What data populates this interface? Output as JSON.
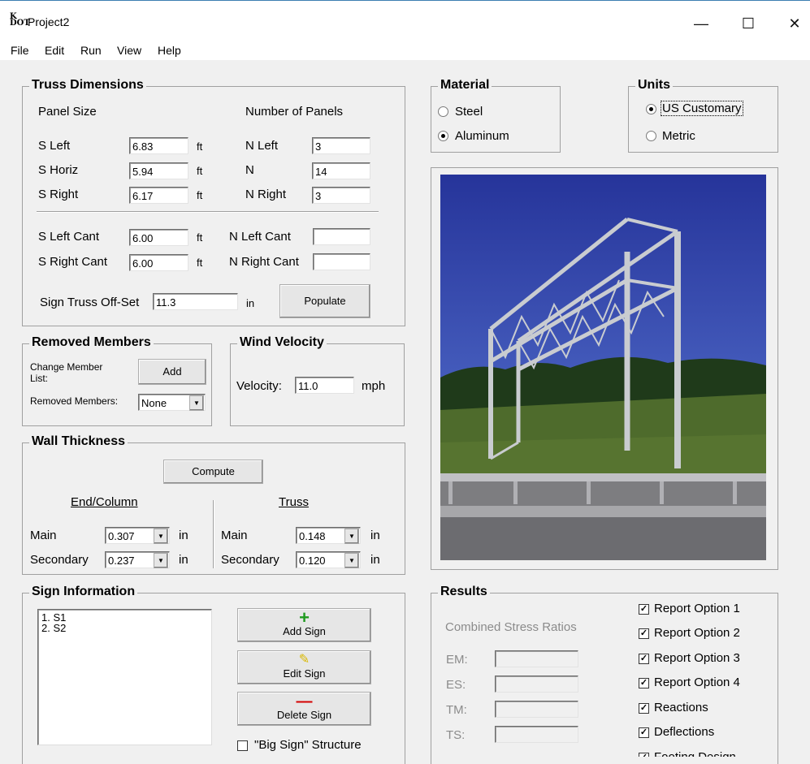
{
  "window": {
    "title": "Project2",
    "app_icon_top": "K",
    "app_icon_bottom": "DOT",
    "minimize": "—",
    "maximize": "☐",
    "close": "✕"
  },
  "menu": [
    "File",
    "Edit",
    "Run",
    "View",
    "Help"
  ],
  "truss": {
    "title": "Truss Dimensions",
    "panel_size": "Panel Size",
    "num_panels": "Number of Panels",
    "s_left": {
      "label": "S Left",
      "value": "6.83",
      "unit": "ft"
    },
    "s_horiz": {
      "label": "S Horiz",
      "value": "5.94",
      "unit": "ft"
    },
    "s_right": {
      "label": "S Right",
      "value": "6.17",
      "unit": "ft"
    },
    "n_left": {
      "label": "N Left",
      "value": "3"
    },
    "n": {
      "label": "N",
      "value": "14"
    },
    "n_right": {
      "label": "N Right",
      "value": "3"
    },
    "s_left_cant": {
      "label": "S Left Cant",
      "value": "6.00",
      "unit": "ft"
    },
    "s_right_cant": {
      "label": "S Right Cant",
      "value": "6.00",
      "unit": "ft"
    },
    "n_left_cant": {
      "label": "N Left Cant",
      "value": ""
    },
    "n_right_cant": {
      "label": "N Right Cant",
      "value": ""
    },
    "offset": {
      "label": "Sign Truss Off-Set",
      "value": "11.3",
      "unit": "in"
    },
    "populate": "Populate"
  },
  "removed": {
    "title": "Removed Members",
    "change_label": "Change Member List:",
    "add": "Add",
    "members_label": "Removed Members:",
    "members_value": "None"
  },
  "wind": {
    "title": "Wind Velocity",
    "label": "Velocity:",
    "value": "11.0",
    "unit": "mph"
  },
  "wall": {
    "title": "Wall Thickness",
    "compute": "Compute",
    "end_column": "End/Column",
    "truss": "Truss",
    "main": "Main",
    "secondary": "Secondary",
    "unit": "in",
    "ec_main": "0.307",
    "ec_secondary": "0.237",
    "tr_main": "0.148",
    "tr_secondary": "0.120"
  },
  "sign": {
    "title": "Sign Information",
    "items": [
      "1.  S1",
      "2.  S2"
    ],
    "add": "Add Sign",
    "edit": "Edit Sign",
    "delete": "Delete Sign",
    "big_sign": "\"Big Sign\" Structure"
  },
  "material": {
    "title": "Material",
    "steel": "Steel",
    "aluminum": "Aluminum",
    "selected": "Aluminum"
  },
  "units": {
    "title": "Units",
    "us": "US Customary",
    "metric": "Metric",
    "selected": "US Customary"
  },
  "results": {
    "title": "Results",
    "csr": "Combined Stress Ratios",
    "em": "EM:",
    "es": "ES:",
    "tm": "TM:",
    "ts": "TS:",
    "options": [
      "Report Option 1",
      "Report Option 2",
      "Report Option 3",
      "Report Option 4",
      "Reactions",
      "Deflections",
      "Footing Design"
    ]
  },
  "colors": {
    "sky": "#2d3c9c",
    "grass": "#4e6b2c",
    "trees": "#1f3a1a",
    "road": "#7d7d80",
    "truss": "#c9ccd0"
  }
}
